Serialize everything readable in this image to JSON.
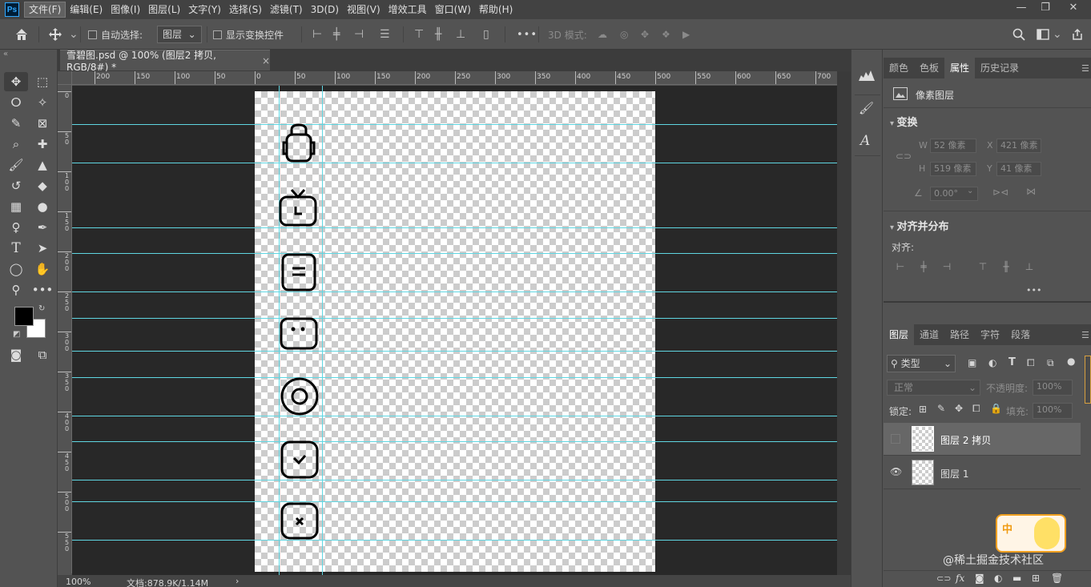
{
  "menu": {
    "logo": "Ps",
    "items": [
      "文件(F)",
      "编辑(E)",
      "图像(I)",
      "图层(L)",
      "文字(Y)",
      "选择(S)",
      "滤镜(T)",
      "3D(D)",
      "视图(V)",
      "增效工具",
      "窗口(W)",
      "帮助(H)"
    ],
    "window_controls": [
      "—",
      "❐",
      "✕"
    ]
  },
  "options": {
    "auto_select_label": "自动选择:",
    "auto_select_value": "图层",
    "show_transform_label": "显示变换控件",
    "more": "•••",
    "mode_3d_label": "3D 模式:"
  },
  "document": {
    "tab_title": "雪碧图.psd @ 100% (图层2 拷贝, RGB/8#) *",
    "close": "×",
    "zoom": "100%",
    "doc_info": "文档:878.9K/1.14M",
    "arrow": "›"
  },
  "ruler_h": [
    "200",
    "150",
    "100",
    "50",
    "0",
    "50",
    "100",
    "150",
    "200",
    "250",
    "300",
    "350",
    "400",
    "450",
    "500",
    "550",
    "600",
    "650",
    "700"
  ],
  "ruler_v": [
    "0",
    "5 0",
    "1 0 0",
    "1 5 0",
    "2 0 0",
    "2 5 0",
    "3 0 0",
    "3 5 0",
    "4 0 0",
    "4 5 0",
    "5 0 0",
    "5 5 0"
  ],
  "panels": {
    "top_tabs": [
      "颜色",
      "色板",
      "属性",
      "历史记录"
    ],
    "active_top_tab": "属性",
    "layer_kind": "像素图层",
    "transform_title": "变换",
    "w_label": "W",
    "w_value": "52 像素",
    "x_label": "X",
    "x_value": "421 像素",
    "h_label": "H",
    "h_value": "519 像素",
    "y_label": "Y",
    "y_value": "41 像素",
    "angle_value": "0.00°",
    "align_title": "对齐并分布",
    "align_label": "对齐:",
    "align_more": "•••",
    "layer_tabs": [
      "图层",
      "通道",
      "路径",
      "字符",
      "段落"
    ],
    "active_layer_tab": "图层",
    "filter_kind": "类型",
    "blend_mode": "正常",
    "opacity_label": "不透明度:",
    "opacity_value": "100%",
    "lock_label": "锁定:",
    "fill_label": "填充:",
    "fill_value": "100%",
    "layers": [
      {
        "name": "图层 2 拷贝",
        "visible": false,
        "selected": true
      },
      {
        "name": "图层 1",
        "visible": true,
        "selected": false
      }
    ],
    "watermark": "@稀土掘金技术社区",
    "ime_char": "中"
  },
  "colors": {
    "guide": "#5fd6e2",
    "workspace": "#282828",
    "panel": "#535353"
  }
}
